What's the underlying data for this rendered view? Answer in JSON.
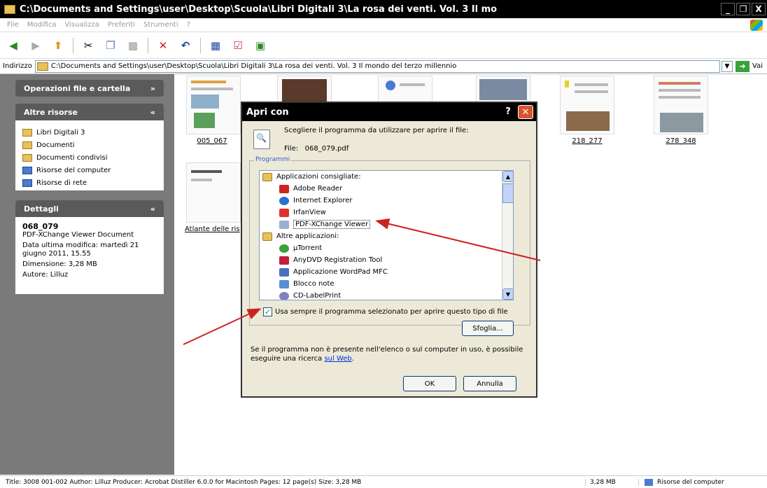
{
  "window": {
    "title": "C:\\Documents and Settings\\user\\Desktop\\Scuola\\Libri Digitali 3\\La rosa dei venti. Vol. 3  Il mo",
    "controls": [
      "_",
      "❐",
      "X"
    ]
  },
  "menu": [
    "File",
    "Modifica",
    "Visualizza",
    "Preferiti",
    "Strumenti",
    "?"
  ],
  "address": {
    "label": "Indirizzo",
    "path": "C:\\Documents and Settings\\user\\Desktop\\Scuola\\Libri Digitali 3\\La rosa dei venti. Vol. 3  Il mondo del terzo millennio",
    "go_label": "Vai"
  },
  "sidebar": {
    "ops_title": "Operazioni file e cartella",
    "resources_title": "Altre risorse",
    "resources": [
      "Libri Digitali 3",
      "Documenti",
      "Documenti condivisi",
      "Risorse del computer",
      "Risorse di rete"
    ],
    "details_title": "Dettagli",
    "details": {
      "name": "068_079",
      "type": "PDF-XChange Viewer Document",
      "modified": "Data ultima modifica: martedì 21 giugno 2011, 15.55",
      "size": "Dimensione: 3,28 MB",
      "author": "Autore: Lilluz"
    }
  },
  "files": {
    "labels": [
      "005_067",
      "218_277",
      "278_348",
      "Atlante delle ris"
    ]
  },
  "dialog": {
    "title": "Apri con",
    "prompt": "Scegliere il programma da utilizzare per aprire il file:",
    "file_label": "File:",
    "file_name": "068_079.pdf",
    "group_title": "Programmi",
    "recommended_header": "Applicazioni consigliate:",
    "recommended": [
      "Adobe Reader",
      "Internet Explorer",
      "IrfanView",
      "PDF-XChange Viewer"
    ],
    "other_header": "Altre applicazioni:",
    "others": [
      "µTorrent",
      "AnyDVD Registration Tool",
      "Applicazione WordPad MFC",
      "Blocco note",
      "CD-LabelPrint"
    ],
    "checkbox_label": "Usa sempre il programma selezionato per aprire questo tipo di file",
    "browse_label": "Sfoglia...",
    "note_text": "Se il programma non è presente nell'elenco o sul computer in uso, è possibile eseguire una ricerca",
    "note_link": "sul Web",
    "ok_label": "OK",
    "cancel_label": "Annulla"
  },
  "statusbar": {
    "info": "Title: 3008 001-002 Author: Lilluz Producer: Acrobat Distiller 6.0.0 for Macintosh Pages: 12 page(s) Size: 3,28 MB",
    "size": "3,28 MB",
    "location": "Risorse del computer"
  },
  "colors": {
    "annotation_arrow": "#cc2222",
    "titlebar": "#000000",
    "sidebar_bg": "#7a7a7a"
  }
}
